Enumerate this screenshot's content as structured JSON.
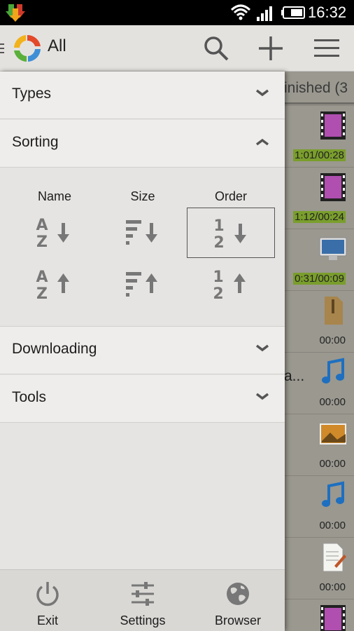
{
  "status_bar": {
    "time": "16:32"
  },
  "action_bar": {
    "title": "All",
    "icons": {
      "logo": "app-refresh-logo",
      "search": "search-icon",
      "add": "plus-icon",
      "menu": "menu-icon"
    }
  },
  "background_list": {
    "tab_label": "inished (3",
    "rows": [
      {
        "icon": "video-icon",
        "time": "1:01/00:28",
        "highlight": true
      },
      {
        "icon": "video-icon",
        "time": "1:12/00:24",
        "highlight": true
      },
      {
        "icon": "monitor-icon",
        "time": "0:31/00:09",
        "highlight": true
      },
      {
        "icon": "archive-icon",
        "time": "00:00",
        "highlight": false
      },
      {
        "icon": "music-icon",
        "time": "00:00",
        "highlight": false,
        "name_fragment": "a..."
      },
      {
        "icon": "image-icon",
        "time": "00:00",
        "highlight": false
      },
      {
        "icon": "music-icon",
        "time": "00:00",
        "highlight": false
      },
      {
        "icon": "document-icon",
        "time": "00:00",
        "highlight": false
      },
      {
        "icon": "video-icon",
        "time": "",
        "highlight": false
      }
    ]
  },
  "drawer": {
    "sections": {
      "types": "Types",
      "sorting": "Sorting",
      "downloading": "Downloading",
      "tools": "Tools"
    },
    "sorting": {
      "columns": [
        "Name",
        "Size",
        "Order"
      ],
      "selected": "order-descending"
    },
    "footer": {
      "exit": "Exit",
      "settings": "Settings",
      "browser": "Browser"
    }
  },
  "colors": {
    "green_time": "#7a9e2c",
    "drawer_bg": "#e6e4e2",
    "action_bar_bg": "#e4e2df"
  }
}
